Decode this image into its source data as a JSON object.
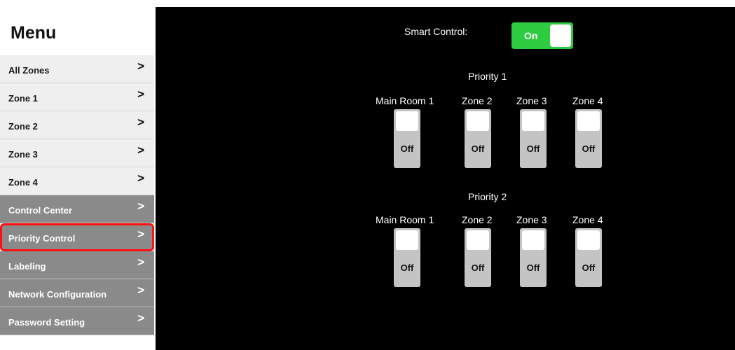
{
  "sidebar": {
    "title": "Menu",
    "items": [
      {
        "label": "All Zones"
      },
      {
        "label": "Zone 1"
      },
      {
        "label": "Zone 2"
      },
      {
        "label": "Zone 3"
      },
      {
        "label": "Zone 4"
      },
      {
        "label": "Control Center"
      },
      {
        "label": "Priority Control"
      },
      {
        "label": "Labeling"
      },
      {
        "label": "Network Configuration"
      },
      {
        "label": "Password Setting"
      }
    ],
    "chevron": ">"
  },
  "main": {
    "smart_control": {
      "label": "Smart Control:",
      "state": "On"
    },
    "priorities": [
      {
        "title": "Priority 1",
        "zones": [
          {
            "label": "Main Room 1",
            "state": "Off"
          },
          {
            "label": "Zone 2",
            "state": "Off"
          },
          {
            "label": "Zone 3",
            "state": "Off"
          },
          {
            "label": "Zone 4",
            "state": "Off"
          }
        ]
      },
      {
        "title": "Priority 2",
        "zones": [
          {
            "label": "Main Room 1",
            "state": "Off"
          },
          {
            "label": "Zone 2",
            "state": "Off"
          },
          {
            "label": "Zone 3",
            "state": "Off"
          },
          {
            "label": "Zone 4",
            "state": "Off"
          }
        ]
      }
    ]
  },
  "colors": {
    "toggle_on": "#2ecc40",
    "highlight": "#ff1111",
    "panel_bg": "#000000",
    "menu_light": "#efefef",
    "menu_dark": "#8a8a8a"
  }
}
